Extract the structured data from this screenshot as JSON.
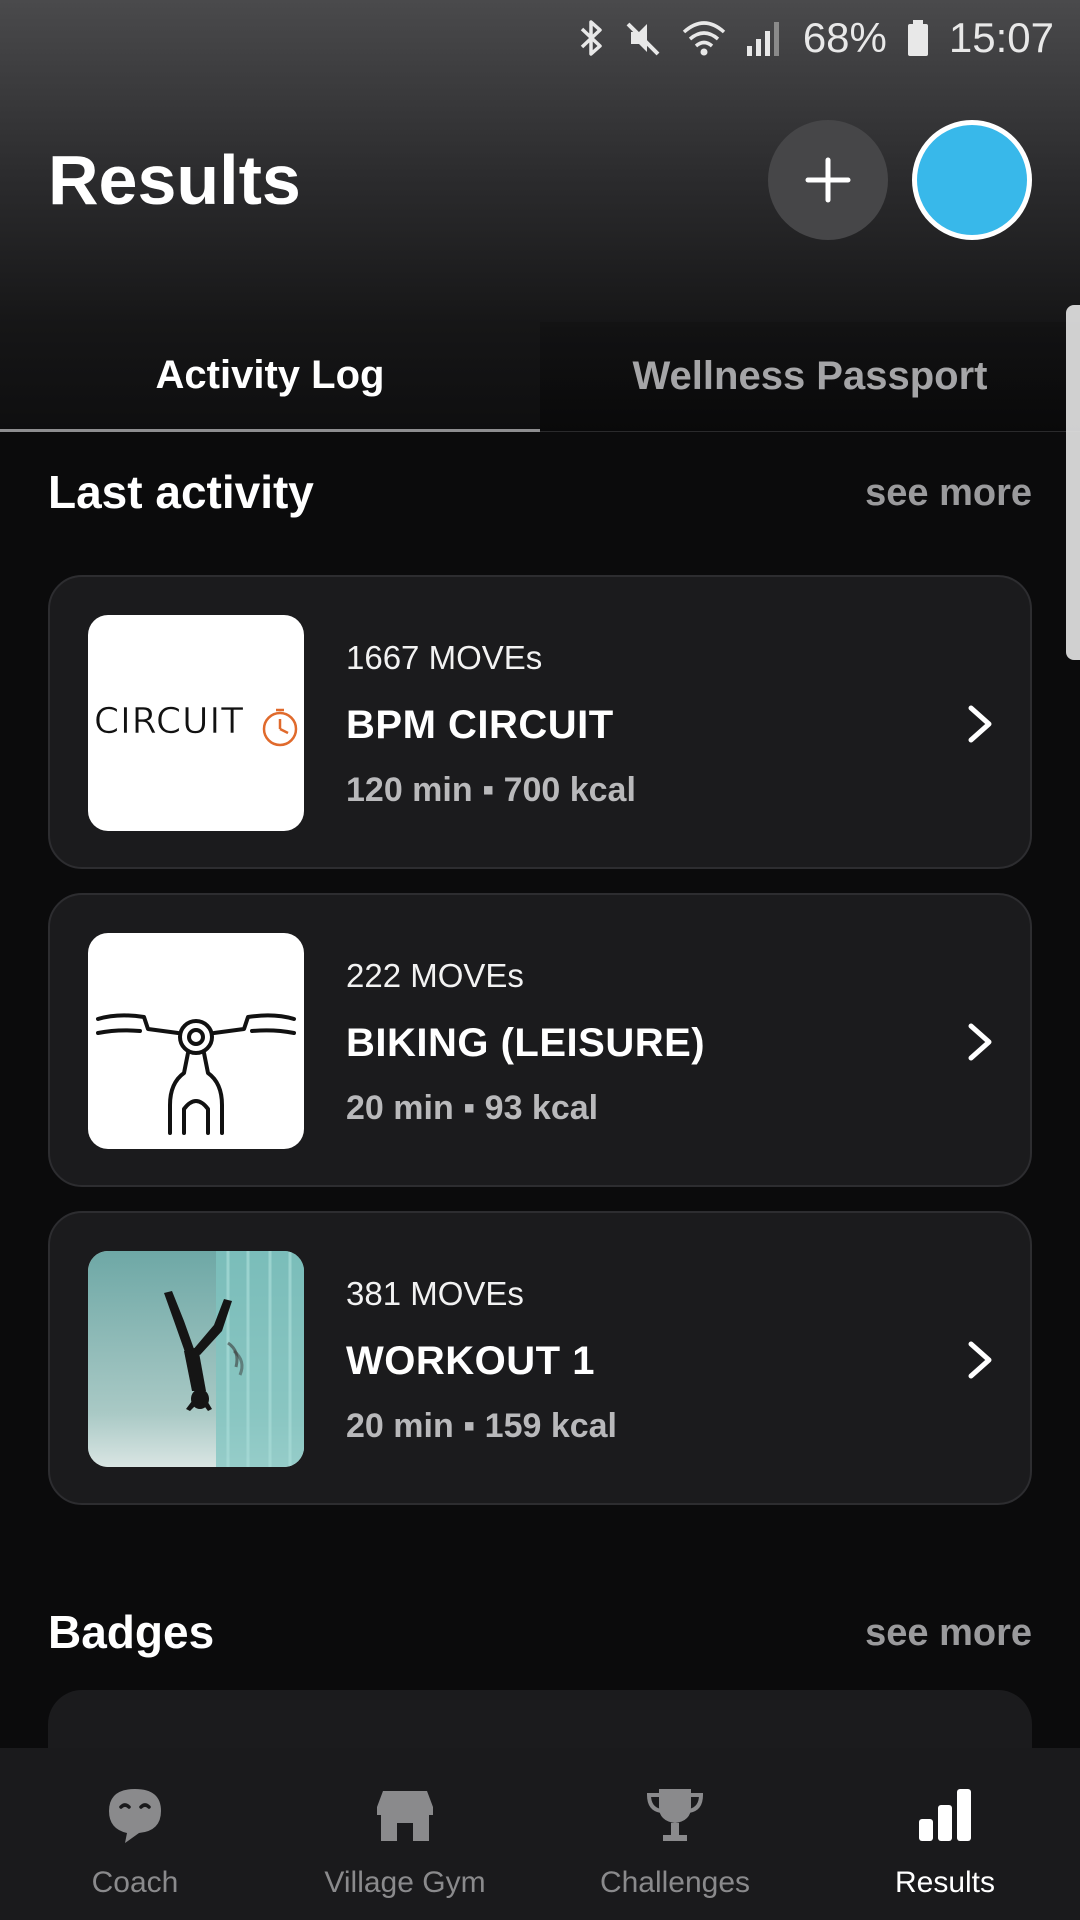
{
  "status_bar": {
    "battery": "68%",
    "time": "15:07",
    "icons": [
      "bluetooth-icon",
      "mute-icon",
      "wifi-icon",
      "signal-icon",
      "battery-icon"
    ]
  },
  "header": {
    "title": "Results",
    "add_icon": "plus-icon",
    "avatar_color": "#38b8ea"
  },
  "tabs": [
    {
      "label": "Activity Log",
      "active": true
    },
    {
      "label": "Wellness Passport",
      "active": false
    }
  ],
  "last_activity": {
    "title": "Last activity",
    "see_more": "see more",
    "items": [
      {
        "moves": "1667 MOVEs",
        "name": "BPM CIRCUIT",
        "meta": "120 min ▪ 700 kcal",
        "thumb": "circuit-logo",
        "logo_text": "CIRCUIT"
      },
      {
        "moves": "222 MOVEs",
        "name": "BIKING (LEISURE)",
        "meta": "20 min ▪ 93 kcal",
        "thumb": "bike-handlebar-icon"
      },
      {
        "moves": "381 MOVEs",
        "name": "WORKOUT 1",
        "meta": "20 min ▪ 159 kcal",
        "thumb": "handstand-photo"
      }
    ]
  },
  "badges": {
    "title": "Badges",
    "see_more": "see more"
  },
  "bottom_nav": [
    {
      "label": "Coach",
      "icon": "coach-chat-icon",
      "active": false
    },
    {
      "label": "Village Gym",
      "icon": "store-icon",
      "active": false
    },
    {
      "label": "Challenges",
      "icon": "trophy-icon",
      "active": false
    },
    {
      "label": "Results",
      "icon": "bar-chart-icon",
      "active": true
    }
  ],
  "colors": {
    "background": "#0b0b0c",
    "card": "#1b1b1d",
    "accent_avatar": "#38b8ea",
    "muted_text": "#9a9a9c"
  }
}
